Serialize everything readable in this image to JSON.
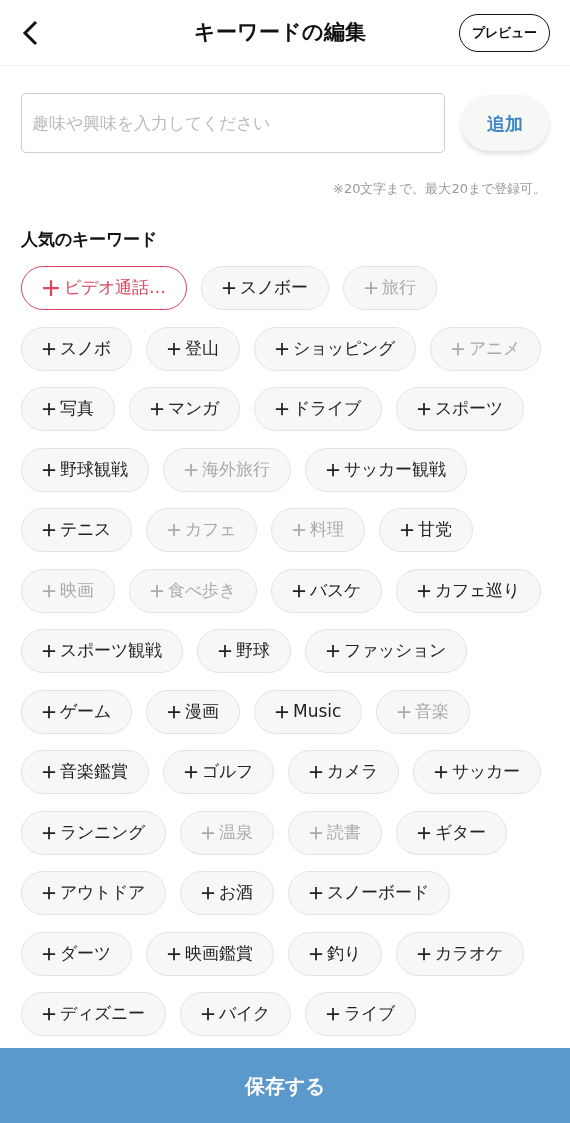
{
  "header": {
    "title": "キーワードの編集",
    "preview_button": "プレビュー"
  },
  "input": {
    "placeholder": "趣味や興味を入力してください",
    "add_button": "追加"
  },
  "note": "※20文字まで。最大20まで登録可。",
  "section_title": "人気のキーワード",
  "keyword_rows": [
    [
      {
        "label": "ビデオ通話…",
        "kind": "highlight",
        "disabled": false
      },
      {
        "label": "スノボー",
        "kind": "normal",
        "disabled": false
      },
      {
        "label": "旅行",
        "kind": "normal",
        "disabled": true
      }
    ],
    [
      {
        "label": "スノボ",
        "kind": "normal",
        "disabled": false
      },
      {
        "label": "登山",
        "kind": "normal",
        "disabled": false
      },
      {
        "label": "ショッピング",
        "kind": "normal",
        "disabled": false
      },
      {
        "label": "アニメ",
        "kind": "normal",
        "disabled": true
      }
    ],
    [
      {
        "label": "写真",
        "kind": "normal",
        "disabled": false
      },
      {
        "label": "マンガ",
        "kind": "normal",
        "disabled": false
      },
      {
        "label": "ドライブ",
        "kind": "normal",
        "disabled": false
      },
      {
        "label": "スポーツ",
        "kind": "normal",
        "disabled": false
      }
    ],
    [
      {
        "label": "野球観戦",
        "kind": "normal",
        "disabled": false
      },
      {
        "label": "海外旅行",
        "kind": "normal",
        "disabled": true
      },
      {
        "label": "サッカー観戦",
        "kind": "normal",
        "disabled": false
      }
    ],
    [
      {
        "label": "テニス",
        "kind": "normal",
        "disabled": false
      },
      {
        "label": "カフェ",
        "kind": "normal",
        "disabled": true
      },
      {
        "label": "料理",
        "kind": "normal",
        "disabled": true
      },
      {
        "label": "甘党",
        "kind": "normal",
        "disabled": false
      }
    ],
    [
      {
        "label": "映画",
        "kind": "normal",
        "disabled": true
      },
      {
        "label": "食べ歩き",
        "kind": "normal",
        "disabled": true
      },
      {
        "label": "バスケ",
        "kind": "normal",
        "disabled": false
      },
      {
        "label": "カフェ巡り",
        "kind": "normal",
        "disabled": false
      }
    ],
    [
      {
        "label": "スポーツ観戦",
        "kind": "normal",
        "disabled": false
      },
      {
        "label": "野球",
        "kind": "normal",
        "disabled": false
      },
      {
        "label": "ファッション",
        "kind": "normal",
        "disabled": false
      }
    ],
    [
      {
        "label": "ゲーム",
        "kind": "normal",
        "disabled": false
      },
      {
        "label": "漫画",
        "kind": "normal",
        "disabled": false
      },
      {
        "label": "Music",
        "kind": "normal",
        "disabled": false
      },
      {
        "label": "音楽",
        "kind": "normal",
        "disabled": true
      }
    ],
    [
      {
        "label": "音楽鑑賞",
        "kind": "normal",
        "disabled": false
      },
      {
        "label": "ゴルフ",
        "kind": "normal",
        "disabled": false
      },
      {
        "label": "カメラ",
        "kind": "normal",
        "disabled": false
      },
      {
        "label": "サッカー",
        "kind": "normal",
        "disabled": false
      }
    ],
    [
      {
        "label": "ランニング",
        "kind": "normal",
        "disabled": false
      },
      {
        "label": "温泉",
        "kind": "normal",
        "disabled": true
      },
      {
        "label": "読書",
        "kind": "normal",
        "disabled": true
      },
      {
        "label": "ギター",
        "kind": "normal",
        "disabled": false
      }
    ],
    [
      {
        "label": "アウトドア",
        "kind": "normal",
        "disabled": false
      },
      {
        "label": "お酒",
        "kind": "normal",
        "disabled": false
      },
      {
        "label": "スノーボード",
        "kind": "normal",
        "disabled": false
      }
    ],
    [
      {
        "label": "ダーツ",
        "kind": "normal",
        "disabled": false
      },
      {
        "label": "映画鑑賞",
        "kind": "normal",
        "disabled": false
      },
      {
        "label": "釣り",
        "kind": "normal",
        "disabled": false
      },
      {
        "label": "カラオケ",
        "kind": "normal",
        "disabled": false
      }
    ],
    [
      {
        "label": "ディズニー",
        "kind": "normal",
        "disabled": false
      },
      {
        "label": "バイク",
        "kind": "normal",
        "disabled": false
      },
      {
        "label": "ライブ",
        "kind": "normal",
        "disabled": false
      }
    ]
  ],
  "save_button": "保存する"
}
